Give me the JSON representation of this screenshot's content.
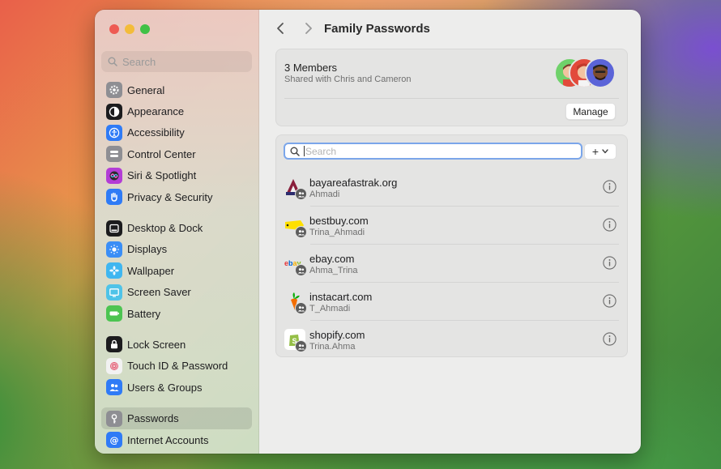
{
  "window": {
    "title": "Family Passwords"
  },
  "sidebar": {
    "search_placeholder": "Search",
    "groups": [
      [
        {
          "label": "General",
          "icon": "gear-icon",
          "color": "#8e8e93"
        },
        {
          "label": "Appearance",
          "icon": "appearance-icon",
          "color": "#1c1c1e"
        },
        {
          "label": "Accessibility",
          "icon": "accessibility-icon",
          "color": "#2f7bf6"
        },
        {
          "label": "Control Center",
          "icon": "control-center-icon",
          "color": "#8e8e93"
        },
        {
          "label": "Siri & Spotlight",
          "icon": "siri-icon",
          "color": "#b33dd6"
        },
        {
          "label": "Privacy & Security",
          "icon": "hand-icon",
          "color": "#2f7bf6"
        }
      ],
      [
        {
          "label": "Desktop & Dock",
          "icon": "dock-icon",
          "color": "#1c1c1e"
        },
        {
          "label": "Displays",
          "icon": "sun-icon",
          "color": "#3a8ef6"
        },
        {
          "label": "Wallpaper",
          "icon": "flower-icon",
          "color": "#3fb6f0"
        },
        {
          "label": "Screen Saver",
          "icon": "screen-saver-icon",
          "color": "#4fc3e8"
        },
        {
          "label": "Battery",
          "icon": "battery-icon",
          "color": "#4cc451"
        }
      ],
      [
        {
          "label": "Lock Screen",
          "icon": "lock-icon",
          "color": "#1c1c1e"
        },
        {
          "label": "Touch ID & Password",
          "icon": "fingerprint-icon",
          "color": "#f2f2f2"
        },
        {
          "label": "Users & Groups",
          "icon": "users-icon",
          "color": "#2f7bf6"
        }
      ],
      [
        {
          "label": "Passwords",
          "icon": "key-icon",
          "color": "#8e8e93",
          "selected": true
        },
        {
          "label": "Internet Accounts",
          "icon": "at-icon",
          "color": "#2f7bf6"
        }
      ]
    ]
  },
  "members": {
    "title": "3 Members",
    "subtitle": "Shared with Chris and Cameron",
    "manage_label": "Manage"
  },
  "passwords": {
    "search_placeholder": "Search",
    "search_value": "",
    "add_label": "+",
    "items": [
      {
        "site": "bayareafastrak.org",
        "user": "Ahmadi",
        "icon": "fastrak-logo-icon"
      },
      {
        "site": "bestbuy.com",
        "user": "Trina_Ahmadi",
        "icon": "bestbuy-logo-icon"
      },
      {
        "site": "ebay.com",
        "user": "Ahma_Trina",
        "icon": "ebay-logo-icon"
      },
      {
        "site": "instacart.com",
        "user": "T_Ahmadi",
        "icon": "instacart-logo-icon"
      },
      {
        "site": "shopify.com",
        "user": "Trina.Ahma",
        "icon": "shopify-logo-icon"
      }
    ]
  }
}
